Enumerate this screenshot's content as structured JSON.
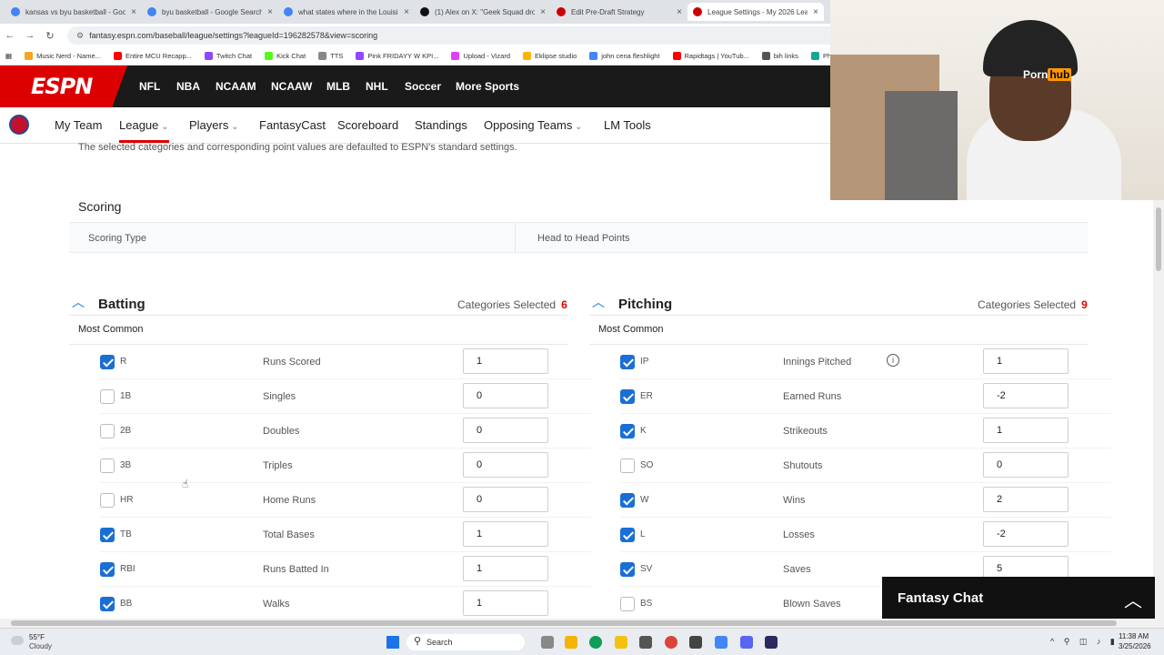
{
  "browser": {
    "tabs": [
      {
        "title": "kansas vs byu basketball - Goo",
        "icon_color": "#4285f4",
        "active": false
      },
      {
        "title": "byu basketball - Google Search",
        "icon_color": "#4285f4",
        "active": false
      },
      {
        "title": "what states where in the Louisi",
        "icon_color": "#4285f4",
        "active": false
      },
      {
        "title": "(1) Alex on X: \"Geek Squad dro",
        "icon_color": "#111111",
        "active": false
      },
      {
        "title": "Edit Pre-Draft Strategy",
        "icon_color": "#cc0000",
        "active": false
      },
      {
        "title": "League Settings - My 2026 Lea",
        "icon_color": "#cc0000",
        "active": true
      }
    ],
    "url": "fantasy.espn.com/baseball/league/settings?leagueId=196282578&view=scoring",
    "bookmarks": [
      {
        "label": "Music Nerd - Name...",
        "color": "#f5a623"
      },
      {
        "label": "Entire MCU Recapp...",
        "color": "#ff0000"
      },
      {
        "label": "Twitch Chat",
        "color": "#9146ff"
      },
      {
        "label": "Kick Chat",
        "color": "#53fc18"
      },
      {
        "label": "TTS",
        "color": "#888888"
      },
      {
        "label": "Pink FRIDAYY W KPI...",
        "color": "#9146ff"
      },
      {
        "label": "Upload - Vizard",
        "color": "#e040fb"
      },
      {
        "label": "Eklipse studio",
        "color": "#ffb300"
      },
      {
        "label": "john cena fleshlight",
        "color": "#4285f4"
      },
      {
        "label": "Rapidtags | YouTub...",
        "color": "#ff0000"
      },
      {
        "label": "bih links",
        "color": "#555555"
      },
      {
        "label": "Photopea",
        "color": "#18a497"
      }
    ]
  },
  "espn": {
    "logo": "ESPN",
    "sports": [
      "NFL",
      "NBA",
      "NCAAM",
      "NCAAW",
      "MLB",
      "NHL",
      "Soccer",
      "More Sports"
    ]
  },
  "fantasy_nav": {
    "items": [
      {
        "label": "My Team",
        "dropdown": false
      },
      {
        "label": "League",
        "dropdown": true,
        "active": true
      },
      {
        "label": "Players",
        "dropdown": true
      },
      {
        "label": "FantasyCast",
        "dropdown": false
      },
      {
        "label": "Scoreboard",
        "dropdown": false
      },
      {
        "label": "Standings",
        "dropdown": false
      },
      {
        "label": "Opposing Teams",
        "dropdown": true
      },
      {
        "label": "LM Tools",
        "dropdown": false
      }
    ]
  },
  "content": {
    "info_text": "The selected categories and corresponding point values are defaulted to ESPN's standard settings.",
    "scoring_title": "Scoring",
    "scoring_type_label": "Scoring Type",
    "scoring_type_value": "Head to Head Points",
    "batting": {
      "title": "Batting",
      "selected_label": "Categories Selected",
      "selected_count": "6",
      "group": "Most Common",
      "rows": [
        {
          "abbr": "R",
          "name": "Runs Scored",
          "value": "1",
          "checked": true
        },
        {
          "abbr": "1B",
          "name": "Singles",
          "value": "0",
          "checked": false
        },
        {
          "abbr": "2B",
          "name": "Doubles",
          "value": "0",
          "checked": false
        },
        {
          "abbr": "3B",
          "name": "Triples",
          "value": "0",
          "checked": false
        },
        {
          "abbr": "HR",
          "name": "Home Runs",
          "value": "0",
          "checked": false
        },
        {
          "abbr": "TB",
          "name": "Total Bases",
          "value": "1",
          "checked": true
        },
        {
          "abbr": "RBI",
          "name": "Runs Batted In",
          "value": "1",
          "checked": true
        },
        {
          "abbr": "BB",
          "name": "Walks",
          "value": "1",
          "checked": true
        }
      ]
    },
    "pitching": {
      "title": "Pitching",
      "selected_label": "Categories Selected",
      "selected_count": "9",
      "group": "Most Common",
      "rows": [
        {
          "abbr": "IP",
          "name": "Innings Pitched",
          "value": "1",
          "checked": true,
          "info": true
        },
        {
          "abbr": "ER",
          "name": "Earned Runs",
          "value": "-2",
          "checked": true
        },
        {
          "abbr": "K",
          "name": "Strikeouts",
          "value": "1",
          "checked": true
        },
        {
          "abbr": "SO",
          "name": "Shutouts",
          "value": "0",
          "checked": false
        },
        {
          "abbr": "W",
          "name": "Wins",
          "value": "2",
          "checked": true
        },
        {
          "abbr": "L",
          "name": "Losses",
          "value": "-2",
          "checked": true
        },
        {
          "abbr": "SV",
          "name": "Saves",
          "value": "5",
          "checked": true
        },
        {
          "abbr": "BS",
          "name": "Blown Saves",
          "value": "",
          "checked": false
        }
      ]
    }
  },
  "chat": {
    "label": "Fantasy Chat"
  },
  "webcam": {
    "beanie_text": "Porn",
    "beanie_badge": "hub"
  },
  "taskbar": {
    "temp": "55°F",
    "weather": "Cloudy",
    "search": "Search",
    "time": "11:38 AM",
    "date": "3/25/2026"
  }
}
